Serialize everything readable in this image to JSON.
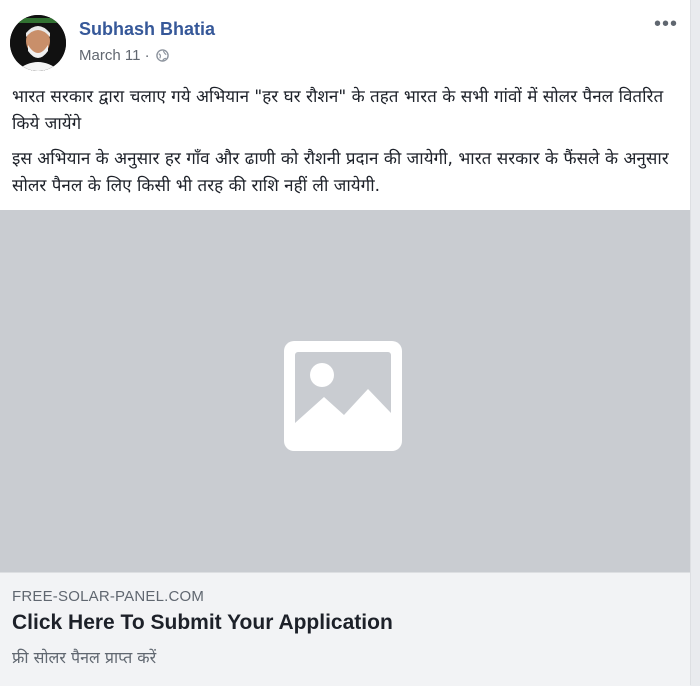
{
  "post": {
    "author": "Subhash Bhatia",
    "date": "March 11",
    "separator": "·",
    "privacy_icon": "globe-icon",
    "more_label": "•••",
    "paragraphs": [
      "भारत सरकार द्वारा चलाए गये अभियान \"हर घर रौशन\" के तहत भारत के सभी गांवों में सोलर पैनल वितरित किये जायेंगे",
      "इस अभियान के अनुसार हर गाँव और ढाणी को रौशनी प्रदान की जायेगी, भारत सरकार के फैंसले के अनुसार सोलर पैनल के लिए किसी भी तरह की राशि नहीं ली जायेगी."
    ]
  },
  "link_preview": {
    "image_icon": "image-placeholder-icon",
    "domain": "FREE-SOLAR-PANEL.COM",
    "title": "Click Here To Submit Your Application",
    "description": "फ्री सोलर पैनल प्राप्त करें"
  },
  "colors": {
    "author_link": "#365899",
    "image_placeholder_bg": "#c9ccd1",
    "link_box_bg": "#f2f3f5"
  }
}
